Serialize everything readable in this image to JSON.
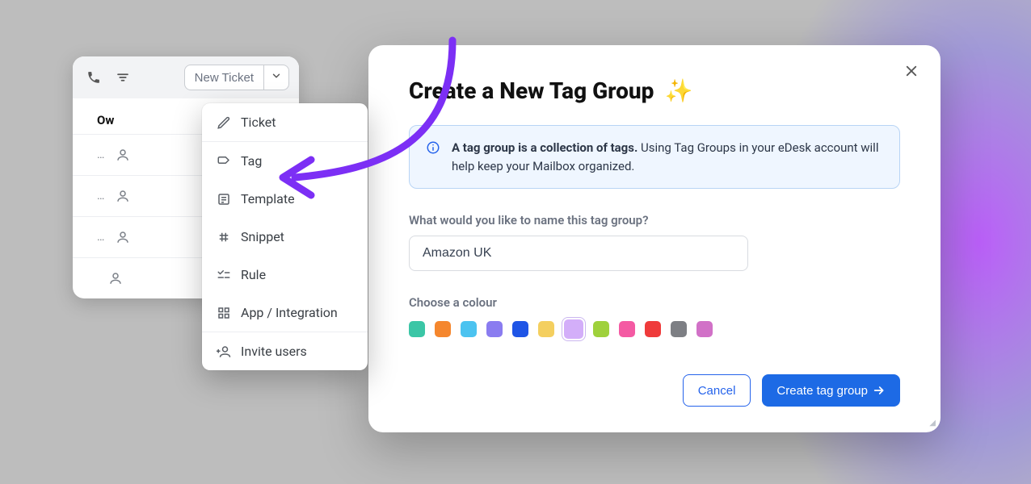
{
  "left": {
    "new_ticket_label": "New Ticket",
    "owner_header": "Ow",
    "menu": {
      "ticket": "Ticket",
      "tag": "Tag",
      "template": "Template",
      "snippet": "Snippet",
      "rule": "Rule",
      "app": "App / Integration",
      "invite": "Invite users"
    }
  },
  "modal": {
    "title": "Create a New Tag Group",
    "sparkle": "✨",
    "info_bold": "A tag group is a collection of tags.",
    "info_rest": " Using Tag Groups in your eDesk account will help keep your Mailbox organized.",
    "name_label": "What would you like to name this tag group?",
    "name_value": "Amazon UK",
    "colour_label": "Choose a colour",
    "colours": [
      "#3bc6a6",
      "#f5872e",
      "#4cc3f0",
      "#8a7cf0",
      "#1f55e6",
      "#f4cf5f",
      "#d3aef9",
      "#9fd13c",
      "#f45aa3",
      "#ef3b3b",
      "#7d7f84",
      "#d171c7"
    ],
    "selected_colour_index": 6,
    "cancel": "Cancel",
    "submit": "Create tag group"
  }
}
